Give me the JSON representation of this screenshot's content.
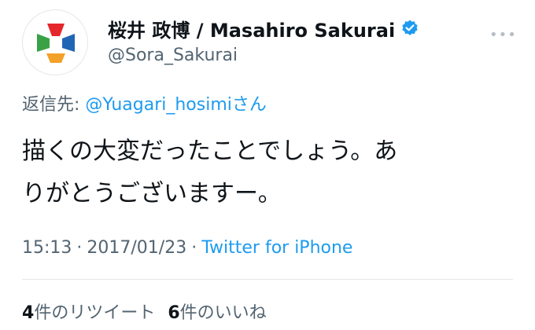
{
  "user": {
    "display_name": "桜井 政博 / Masahiro Sakurai",
    "handle": "@Sora_Sakurai",
    "avatar_icon": "game-controller-dpad-icon",
    "verified_icon": "verified-badge-icon"
  },
  "reply": {
    "prefix": "返信先: ",
    "mention": "@Yuagari_hosimi",
    "suffix": "さん"
  },
  "tweet": {
    "line1": "描くの大変だったことでしょう。あ",
    "line2": "りがとうございますー。"
  },
  "meta": {
    "time": "15:13",
    "date": "2017/01/23",
    "source": "Twitter for iPhone",
    "separator": "·"
  },
  "stats": {
    "retweets_count": "4",
    "retweets_label": "件のリツイート",
    "likes_count": "6",
    "likes_label": "件のいいね"
  },
  "colors": {
    "link": "#1d9bf0",
    "secondary": "#536471",
    "verified": "#1d9bf0"
  }
}
